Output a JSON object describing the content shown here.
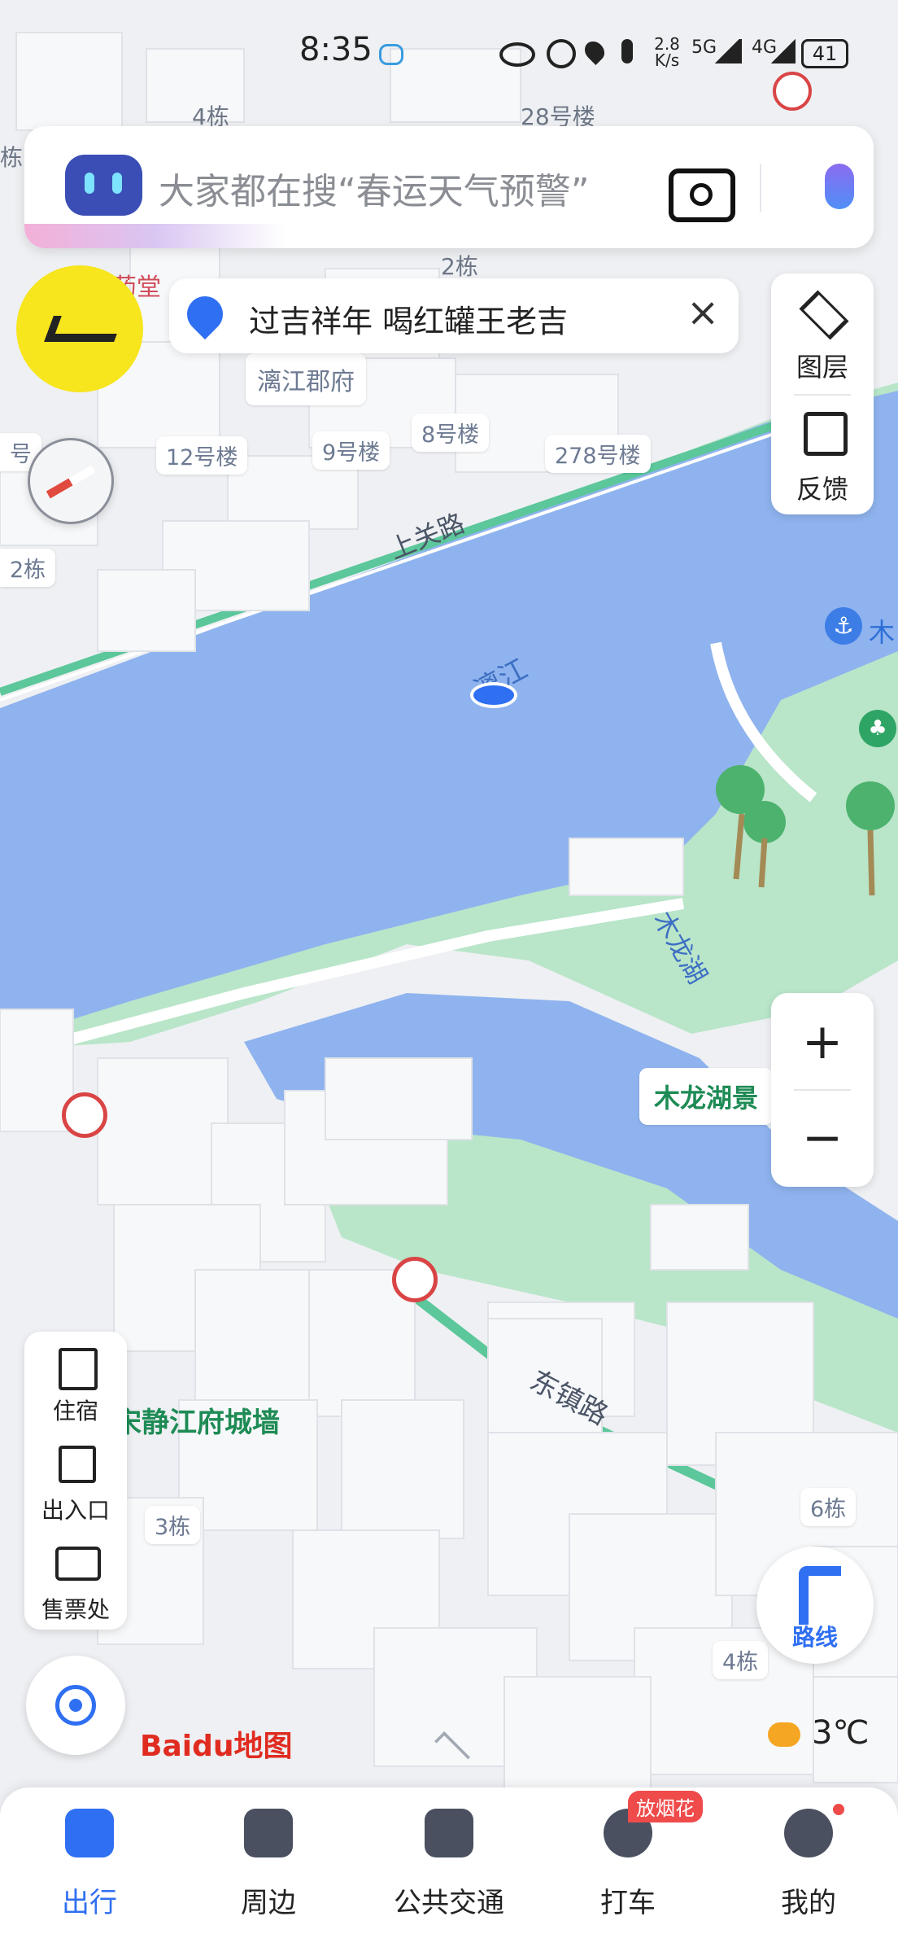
{
  "status_bar": {
    "time": "8:35",
    "network_speed": "2.8 K/s",
    "net_5g": "5G",
    "net_4g": "4G",
    "battery": "41"
  },
  "search": {
    "placeholder": "大家都在搜“春运天气预警”"
  },
  "banner": {
    "text": "过吉祥年 喝红罐王老吉"
  },
  "side_panel": {
    "layers_label": "图层",
    "feedback_label": "反馈"
  },
  "zoom": {
    "plus": "+",
    "minus": "−"
  },
  "left_panel": {
    "lodging_label": "住宿",
    "entrance_label": "出入口",
    "ticket_label": "售票处"
  },
  "route_button": {
    "label": "路线"
  },
  "weather": {
    "temperature": "3℃"
  },
  "logo": {
    "text": "Baidu地图"
  },
  "map_labels": {
    "building_4": "4栋",
    "building_28": "28号楼",
    "building_2": "2栋",
    "pharmacy": "药堂",
    "lijiang_junfu": "漓江郡府",
    "building_12": "12号楼",
    "building_9": "9号楼",
    "building_8": "8号楼",
    "building_278": "278号楼",
    "building_2b": "2栋",
    "shangguan_road": "上关路",
    "lijiang_river": "漓江",
    "mulong_lake": "木龙湖",
    "mulong_scenic": "木龙湖景",
    "dongzhen_road": "东镇路",
    "city_wall": "宋静江府城墙",
    "building_3": "3栋",
    "building_6": "6栋",
    "building_4b": "4栋",
    "mu_partial": "木",
    "edge_hao": "号",
    "edge_dong": "栋"
  },
  "bottom_nav": {
    "items": [
      {
        "label": "出行"
      },
      {
        "label": "周边"
      },
      {
        "label": "公共交通"
      },
      {
        "label": "打车",
        "badge": "放烟花"
      },
      {
        "label": "我的"
      }
    ]
  },
  "colors": {
    "water": "#8fb3ee",
    "park": "#b9e5c9",
    "accent": "#2f6ff2",
    "text": "#222222"
  }
}
